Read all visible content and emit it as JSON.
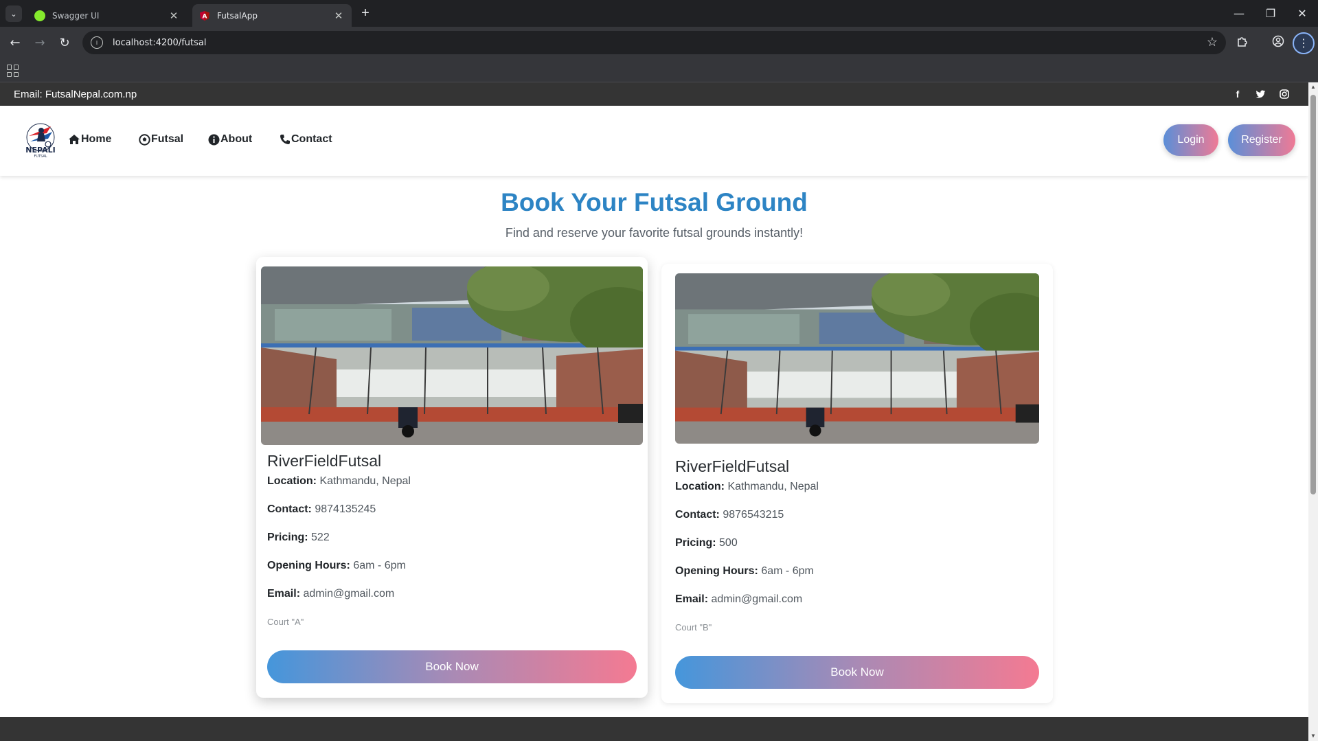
{
  "browser": {
    "tabs": [
      {
        "title": "Swagger UI",
        "favicon_color": "#85ea2d",
        "active": false
      },
      {
        "title": "FutsalApp",
        "favicon_color": "#c3002f",
        "active": true
      }
    ],
    "address": "localhost:4200/futsal",
    "icons": {
      "tab_search": "chevron-down-icon",
      "new_tab": "plus-icon",
      "minimize": "minimize-icon",
      "restore": "restore-icon",
      "close": "close-icon",
      "back": "back-arrow-icon",
      "forward": "forward-arrow-icon",
      "reload": "reload-icon",
      "bookmark": "star-icon",
      "extensions": "puzzle-icon",
      "profile": "profile-icon",
      "menu": "kebab-menu-icon",
      "apps": "apps-grid-icon"
    }
  },
  "topbar": {
    "email_text": "Email: FutsalNepal.com.np",
    "social": [
      "facebook-icon",
      "twitter-icon",
      "instagram-icon"
    ],
    "background": "#343434"
  },
  "navbar": {
    "logo_text": "NEPALI",
    "logo_subtext": "FUTSAL",
    "links": [
      {
        "label": "Home",
        "icon": "home-icon"
      },
      {
        "label": "Futsal",
        "icon": "soccer-ball-icon"
      },
      {
        "label": "About",
        "icon": "info-icon"
      },
      {
        "label": "Contact",
        "icon": "phone-icon"
      }
    ],
    "login_label": "Login",
    "register_label": "Register"
  },
  "hero": {
    "title": "Book Your Futsal Ground",
    "subtitle": "Find and reserve your favorite futsal grounds instantly!"
  },
  "labels": {
    "location": "Location:",
    "contact": "Contact:",
    "pricing": "Pricing:",
    "hours": "Opening Hours:",
    "email": "Email:"
  },
  "cards": [
    {
      "name": "RiverFieldFutsal",
      "location": "Kathmandu, Nepal",
      "contact": "9874135245",
      "pricing": "522",
      "hours": "6am - 6pm",
      "email": "admin@gmail.com",
      "court": "Court \"A\"",
      "button": "Book Now"
    },
    {
      "name": "RiverFieldFutsal",
      "location": "Kathmandu, Nepal",
      "contact": "9876543215",
      "pricing": "500",
      "hours": "6am - 6pm",
      "email": "admin@gmail.com",
      "court": "Court \"B\"",
      "button": "Book Now"
    }
  ],
  "colors": {
    "accent_title": "#2d84c4",
    "gradient_start": "#4596db",
    "gradient_end": "#f47a92"
  }
}
